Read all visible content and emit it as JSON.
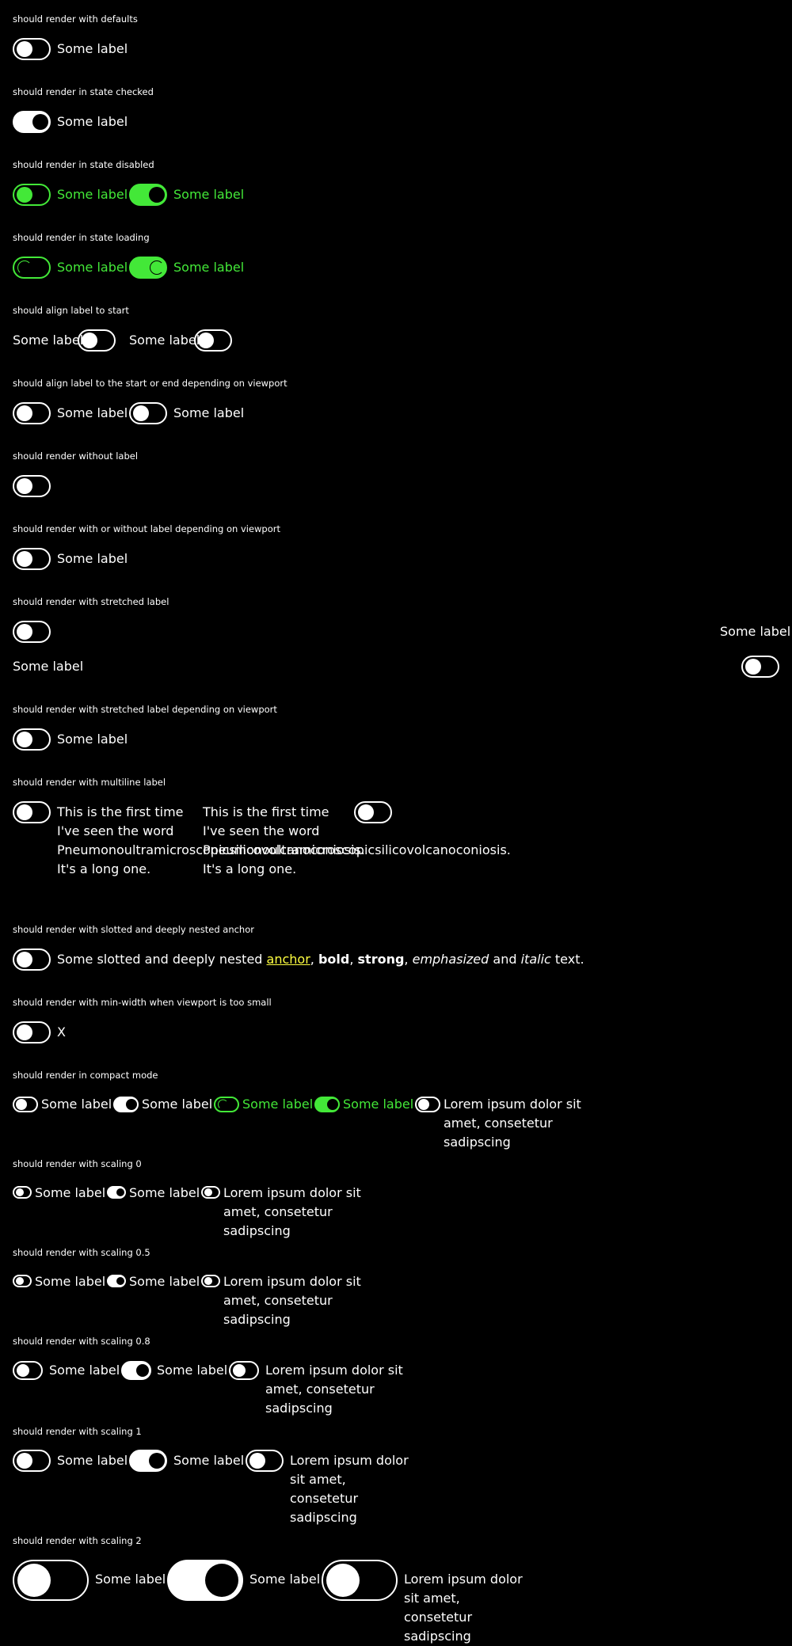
{
  "label": "Some label",
  "sections": {
    "s1": "should render with defaults",
    "s2": "should render in state checked",
    "s3": "should render in state disabled",
    "s4": "should render in state loading",
    "s5": "should align label to start",
    "s6": "should align label to the start or end depending on viewport",
    "s7": "should render without label",
    "s8": "should render with or without label depending on viewport",
    "s9": "should render with stretched label",
    "s10": "should render with stretched label depending on viewport",
    "s11": "should render with multiline label",
    "s12": "should render with slotted and deeply nested anchor",
    "s13": "should render with min-width when viewport is too small",
    "s14": "should render in compact mode",
    "s15": "should render with scaling 0",
    "s16": "should render with scaling 0.5",
    "s17": "should render with scaling 0.8",
    "s18": "should render with scaling 1",
    "s19": "should render with scaling 2"
  },
  "multiline_label": "This is the first time I've seen the word Pneumonoultramicroscopicsilicovolcanoconiosis. It's a long one.",
  "lorem_label": "Lorem ipsum dolor sit amet, consetetur sadipscing",
  "min_width_label": "X",
  "nested": {
    "before": "Some slotted and deeply nested ",
    "anchor": "anchor",
    "comma1": ", ",
    "bold": "bold",
    "comma2": ", ",
    "strong": "strong",
    "comma3": ", ",
    "emphasized": "emphasized",
    "and": " and ",
    "italic": "italic",
    "after": " text."
  },
  "colors": {
    "background": "#000000",
    "foreground": "#ffffff",
    "disabled": "#43e838",
    "anchor": "#ffff40"
  }
}
